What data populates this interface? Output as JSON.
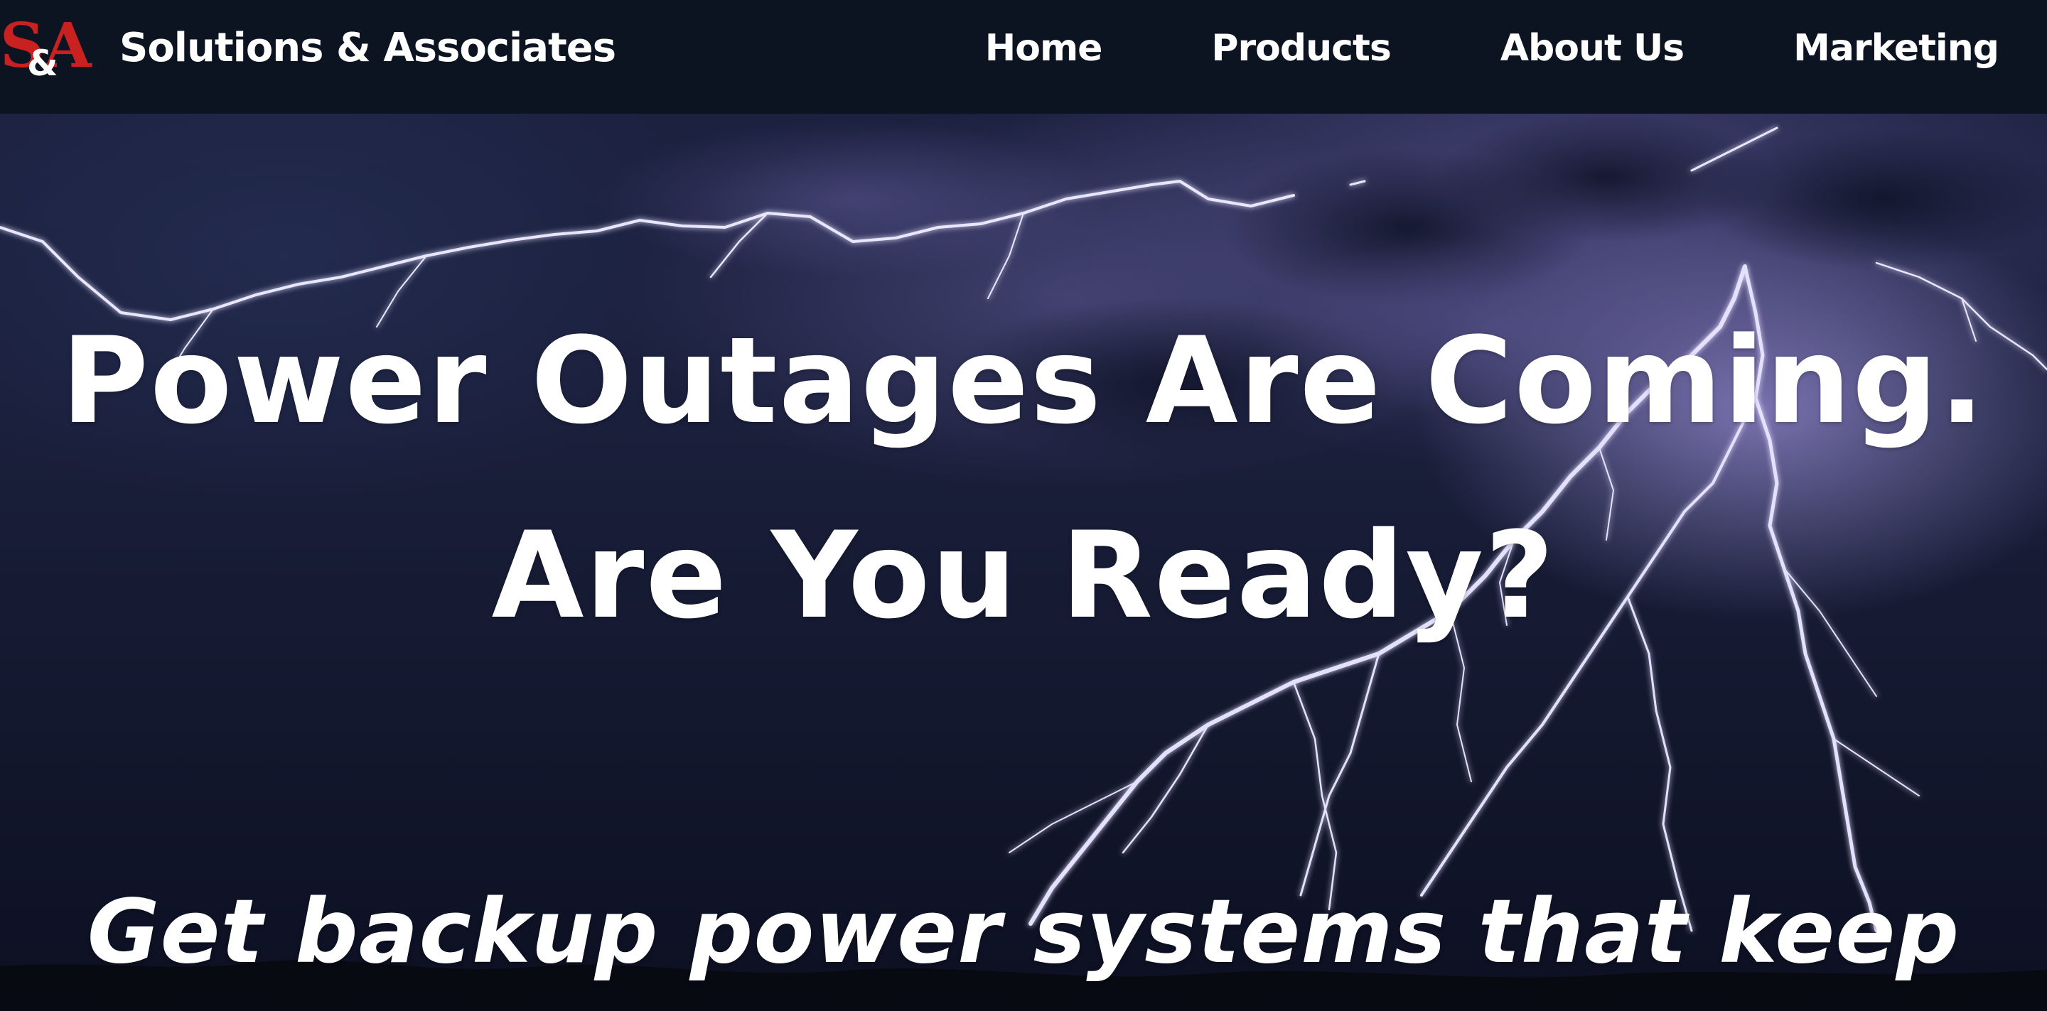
{
  "brand": {
    "logo_text": "S&A",
    "name": "Solutions & Associates",
    "logo_color": "#c8211f"
  },
  "nav": {
    "items": [
      {
        "label": "Home"
      },
      {
        "label": "Products"
      },
      {
        "label": "About Us"
      },
      {
        "label": "Marketing"
      }
    ]
  },
  "hero": {
    "headline_line1": "Power Outages Are Coming.",
    "headline_line2": "Are You Ready?",
    "subheadline": "Get backup power systems that keep",
    "background_image": "storm-lightning-night-sky"
  },
  "colors": {
    "navbar_bg": "#0c1422",
    "text": "#ffffff",
    "accent_red": "#c8211f"
  }
}
